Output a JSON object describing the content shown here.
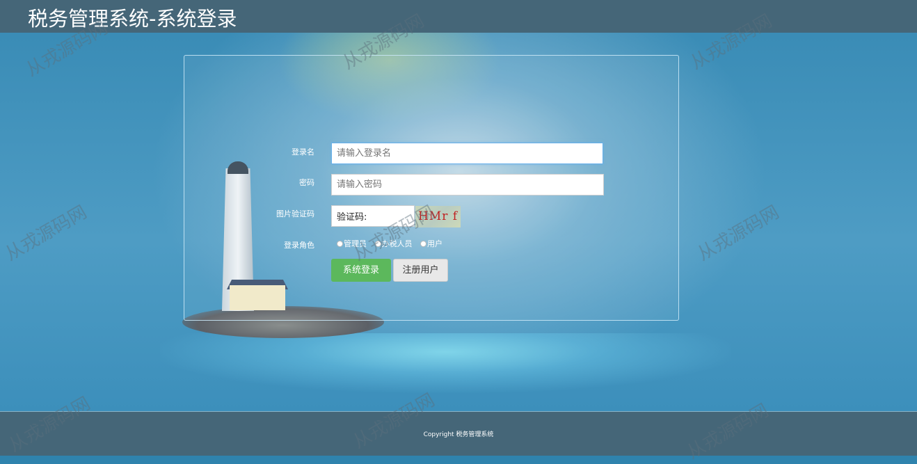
{
  "header": {
    "title": "税务管理系统-系统登录"
  },
  "form": {
    "username": {
      "label": "登录名",
      "placeholder": "请输入登录名"
    },
    "password": {
      "label": "密码",
      "placeholder": "请输入密码"
    },
    "captcha": {
      "label": "图片验证码",
      "value": "验证码:",
      "image_text": "HMr f"
    },
    "role": {
      "label": "登录角色",
      "options": [
        "管理员",
        "办税人员",
        "用户"
      ]
    },
    "login_button": "系统登录",
    "register_button": "注册用户"
  },
  "footer": {
    "copyright": "Copyright 税务管理系统"
  },
  "watermark": "从戎源码网",
  "colors": {
    "header_bg": "#456678",
    "page_bg": "#2f83ad",
    "login_button": "#5cb85c",
    "register_button": "#e8e8e8"
  }
}
